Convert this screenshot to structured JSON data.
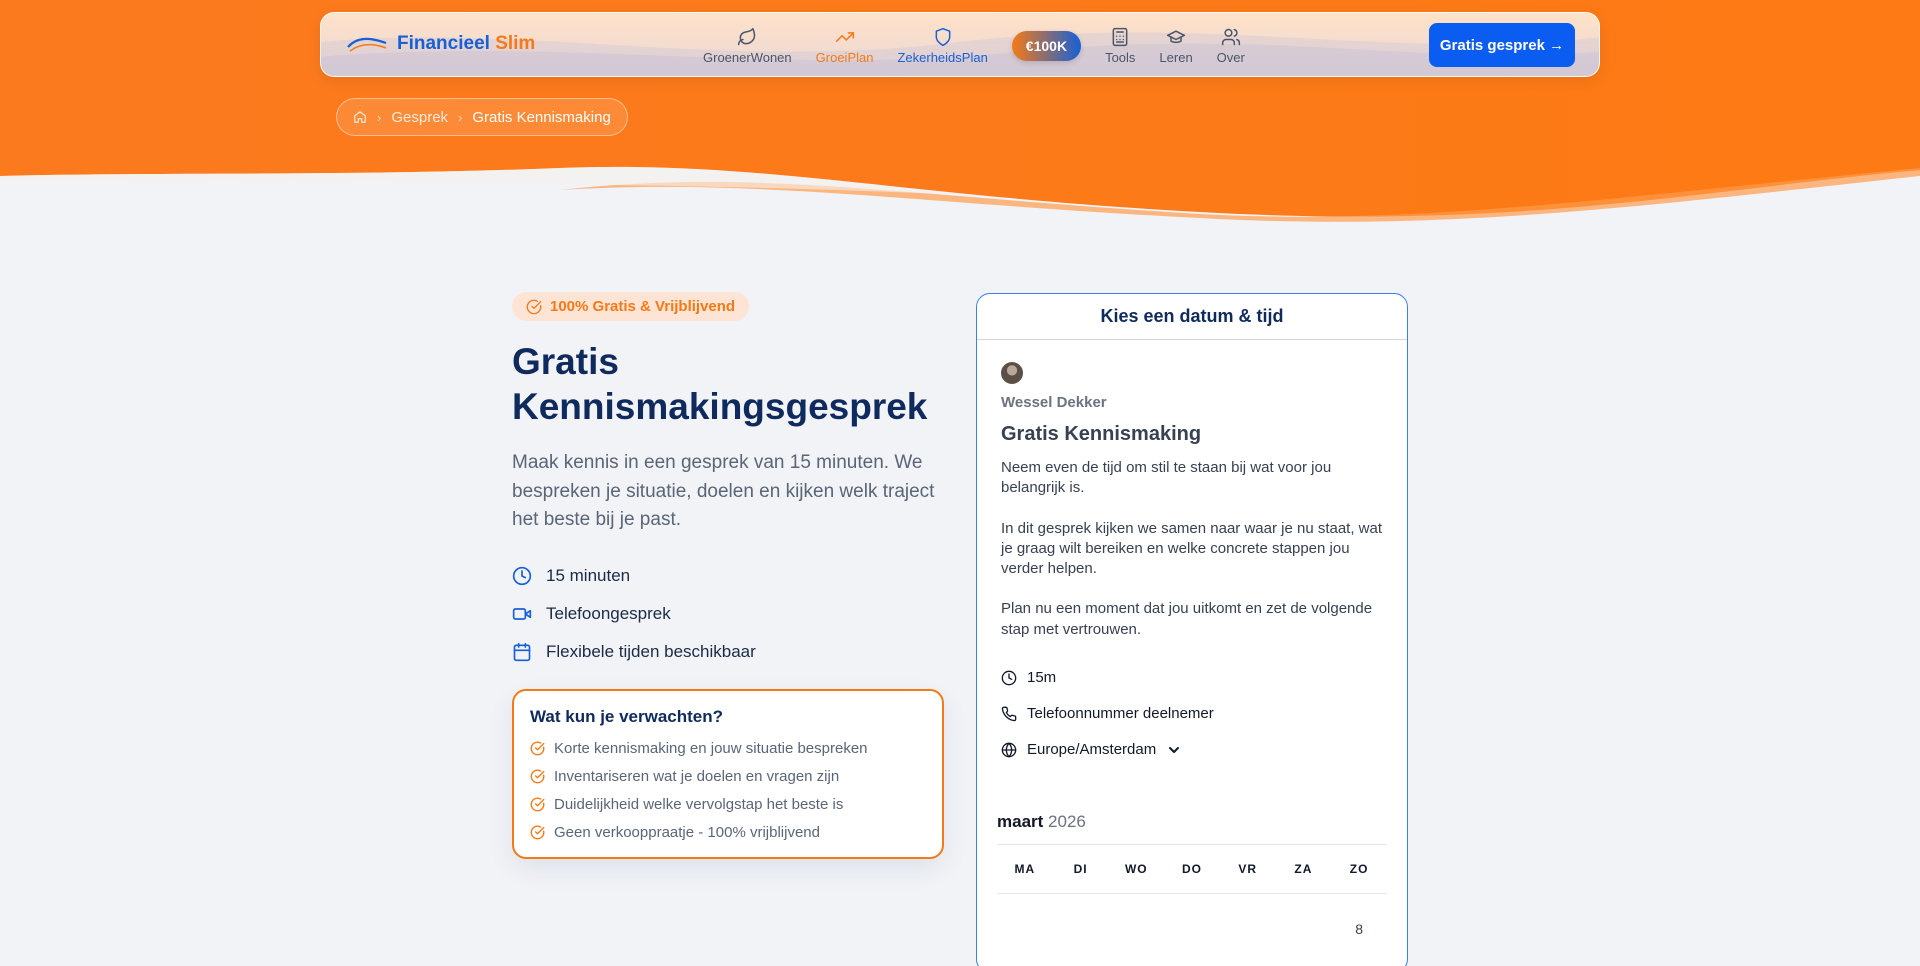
{
  "nav": {
    "logo_primary": "Financieel",
    "logo_accent": "Slim",
    "items": [
      {
        "label": "GroenerWonen",
        "icon": "leaf-icon"
      },
      {
        "label": "GroeiPlan",
        "icon": "trending-up-icon"
      },
      {
        "label": "ZekerheidsPlan",
        "icon": "shield-icon"
      },
      {
        "label": "Tools",
        "icon": "calculator-icon"
      },
      {
        "label": "Leren",
        "icon": "graduation-cap-icon"
      },
      {
        "label": "Over",
        "icon": "users-icon"
      }
    ],
    "badge": "€100K",
    "cta": "Gratis gesprek →"
  },
  "breadcrumb": {
    "items": [
      "Gesprek",
      "Gratis Kennismaking"
    ]
  },
  "intro": {
    "pill": "100% Gratis & Vrijblijvend",
    "title": "Gratis Kennismakingsgesprek",
    "lead": "Maak kennis in een gesprek van 15 minuten. We bespreken je situatie, doelen en kijken welk traject het beste bij je past.",
    "features": [
      "15 minuten",
      "Telefoongesprek",
      "Flexibele tijden beschikbaar"
    ]
  },
  "expect": {
    "title": "Wat kun je verwachten?",
    "items": [
      "Korte kennismaking en jouw situatie bespreken",
      "Inventariseren wat je doelen en vragen zijn",
      "Duidelijkheid welke vervolgstap het beste is",
      "Geen verkooppraatje - 100% vrijblijvend"
    ]
  },
  "booking": {
    "header": "Kies een datum & tijd",
    "host": "Wessel Dekker",
    "event_title": "Gratis Kennismaking",
    "description": [
      "Neem even de tijd om stil te staan bij wat voor jou belangrijk is.",
      "In dit gesprek kijken we samen naar waar je nu staat, wat je graag wilt bereiken en welke concrete stappen jou verder helpen.",
      "Plan nu een moment dat jou uitkomt en zet de volgende stap met vertrouwen."
    ],
    "duration": "15m",
    "location": "Telefoonnummer deelnemer",
    "timezone": "Europe/Amsterdam",
    "month": "maart",
    "year": "2026",
    "weekdays": [
      "MA",
      "DI",
      "WO",
      "DO",
      "VR",
      "ZA",
      "ZO"
    ],
    "first_visible_day": "8"
  },
  "colors": {
    "orange": "#f57a16",
    "blue": "#0b5cf0",
    "navy": "#0f2a5c",
    "background": "#f1f3f7"
  }
}
